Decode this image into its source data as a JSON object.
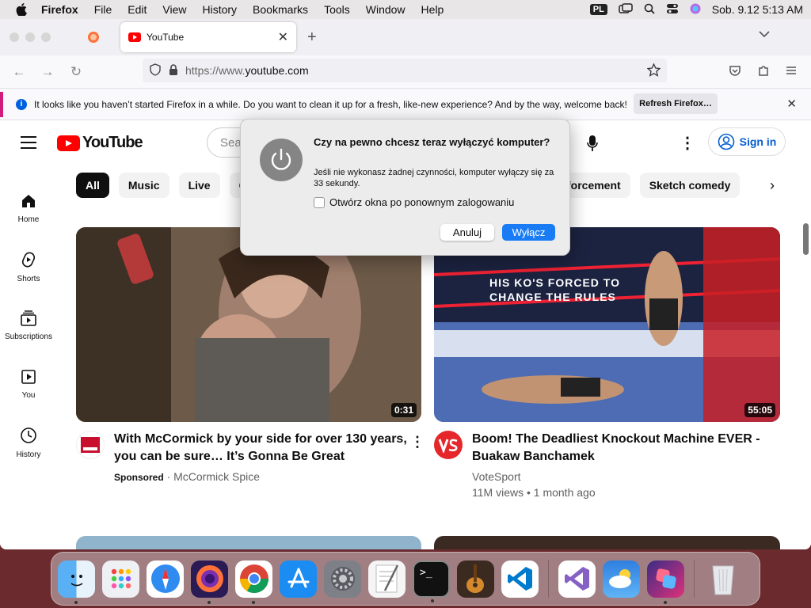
{
  "menubar": {
    "app": "Firefox",
    "items": [
      "File",
      "Edit",
      "View",
      "History",
      "Bookmarks",
      "Tools",
      "Window",
      "Help"
    ],
    "input_source": "PL",
    "datetime": "Sob. 9.12  5:13 AM"
  },
  "browser": {
    "tab_title": "YouTube",
    "url_scheme": "https://www.",
    "url_host": "youtube.com",
    "notification": "It looks like you haven’t started Firefox in a while. Do you want to clean it up for a fresh, like-new experience? And by the way, welcome back!",
    "refresh_button": "Refresh Firefox…"
  },
  "youtube": {
    "logo": "YouTube",
    "search_placeholder": "Sea",
    "signin": "Sign in",
    "chips": [
      "All",
      "Music",
      "Live",
      "C"
    ],
    "chips_right": [
      "forcement",
      "Sketch comedy"
    ],
    "sidebar": [
      {
        "label": "Home",
        "icon": "home-icon"
      },
      {
        "label": "Shorts",
        "icon": "shorts-icon"
      },
      {
        "label": "Subscriptions",
        "icon": "subscriptions-icon"
      },
      {
        "label": "You",
        "icon": "you-icon"
      },
      {
        "label": "History",
        "icon": "history-icon"
      }
    ],
    "videos": [
      {
        "title_line1": "With McCormick by your side for over 130 years,",
        "title_line2": "you can be sure… It’s Gonna Be Great",
        "sponsored": "Sponsored",
        "channel": "· McCormick Spice",
        "duration": "0:31"
      },
      {
        "title_line1": "Boom! The Deadliest Knockout Machine EVER -",
        "title_line2": "Buakaw Banchamek",
        "channel": "VoteSport",
        "meta": "11M views • 1 month ago",
        "duration": "55:05",
        "overlay_line1": "HIS KO'S FORCED TO",
        "overlay_line2": "CHANGE THE RULES"
      }
    ]
  },
  "dialog": {
    "title": "Czy na pewno chcesz teraz wyłączyć komputer?",
    "message": "Jeśli nie wykonasz żadnej czynności, komputer wyłączy się za 33 sekundy.",
    "checkbox_label": "Otwórz okna po ponownym zalogowaniu",
    "cancel": "Anuluj",
    "confirm": "Wyłącz"
  },
  "dock": {
    "apps": [
      "finder",
      "launchpad",
      "safari",
      "firefox",
      "chrome",
      "app-store",
      "system-settings",
      "textedit",
      "terminal",
      "garageband",
      "vscode",
      "visual-studio",
      "weather",
      "shortcuts",
      "trash"
    ]
  },
  "colors": {
    "accent": "#1a7cf5",
    "youtube_red": "#ff0000",
    "link_blue": "#065fd4"
  }
}
